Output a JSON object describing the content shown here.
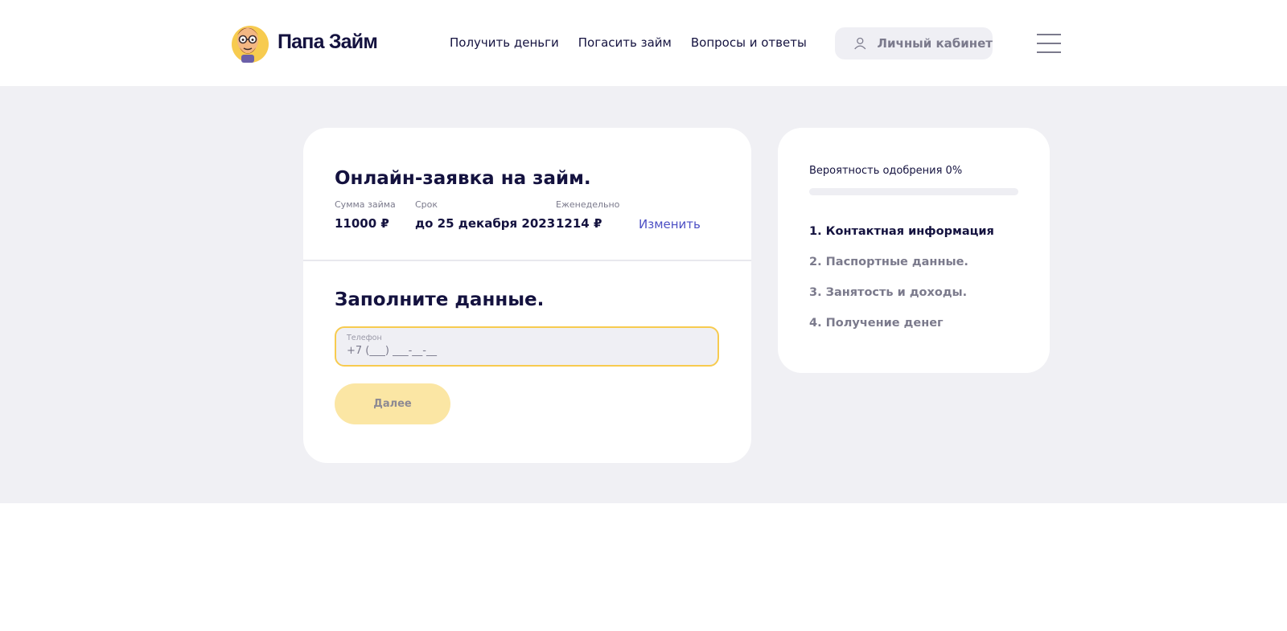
{
  "header": {
    "brand": "Папа Займ",
    "nav": [
      {
        "label": "Получить деньги"
      },
      {
        "label": "Погасить займ"
      },
      {
        "label": "Вопросы и ответы"
      }
    ],
    "account_label": "Личный кабинет"
  },
  "form": {
    "title": "Онлайн-заявка на займ.",
    "summary": [
      {
        "label": "Сумма займа",
        "value": "11000 ₽"
      },
      {
        "label": "Срок",
        "value": "до 25 декабря 2023"
      },
      {
        "label": "Еженедельно",
        "value": "1214 ₽"
      }
    ],
    "change_label": "Изменить",
    "section_title": "Заполните данные.",
    "phone": {
      "label": "Телефон",
      "placeholder": "+7 (___) ___-__-__"
    },
    "next_label": "Далее"
  },
  "progress": {
    "approval_label": "Вероятность одобрения 0%",
    "approval_fraction": 0,
    "steps": [
      {
        "label": "1. Контактная информация",
        "active": true
      },
      {
        "label": "2. Паспортные данные.",
        "active": false
      },
      {
        "label": "3. Занятость и доходы.",
        "active": false
      },
      {
        "label": "4. Получение денег",
        "active": false
      }
    ]
  },
  "colors": {
    "accent": "#f7cb4f",
    "accent_light": "#fbe6a4",
    "text_dark": "#14123f",
    "link": "#4c4fc4",
    "muted": "#7b7a8c",
    "background": "#f0f0f4"
  },
  "icons": {
    "logo": "papa-mascot-logo",
    "account": "user-icon",
    "menu": "hamburger-menu-icon"
  }
}
